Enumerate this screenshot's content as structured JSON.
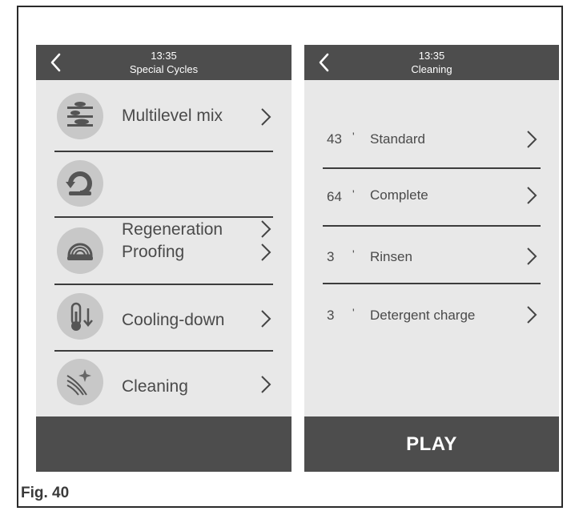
{
  "left_screen": {
    "header": {
      "time": "13:35",
      "title": "Special Cycles"
    },
    "items": [
      {
        "label": "Multilevel mix",
        "icon": "multilevel-mix-icon"
      },
      {
        "label": "Regeneration",
        "icon": "regeneration-icon"
      },
      {
        "label": "Proofing",
        "icon": "proofing-icon"
      },
      {
        "label": "Cooling-down",
        "icon": "thermometer-down-icon"
      },
      {
        "label": "Cleaning",
        "icon": "cleaning-sparkle-icon"
      }
    ]
  },
  "right_screen": {
    "header": {
      "time": "13:35",
      "title": "Cleaning"
    },
    "items": [
      {
        "minutes": "43",
        "tick": "'",
        "label": "Standard"
      },
      {
        "minutes": "64",
        "tick": "'",
        "label": "Complete"
      },
      {
        "minutes": "3",
        "tick": "'",
        "label": "Rinsen"
      },
      {
        "minutes": "3",
        "tick": "'",
        "label": "Detergent charge"
      }
    ],
    "play_label": "PLAY"
  },
  "caption": "Fig. 40",
  "colors": {
    "header_bar": "#4d4d4d",
    "screen_bg": "#e8e8e8",
    "icon_circle": "#c8c8c8",
    "text": "#4a4a4a"
  }
}
